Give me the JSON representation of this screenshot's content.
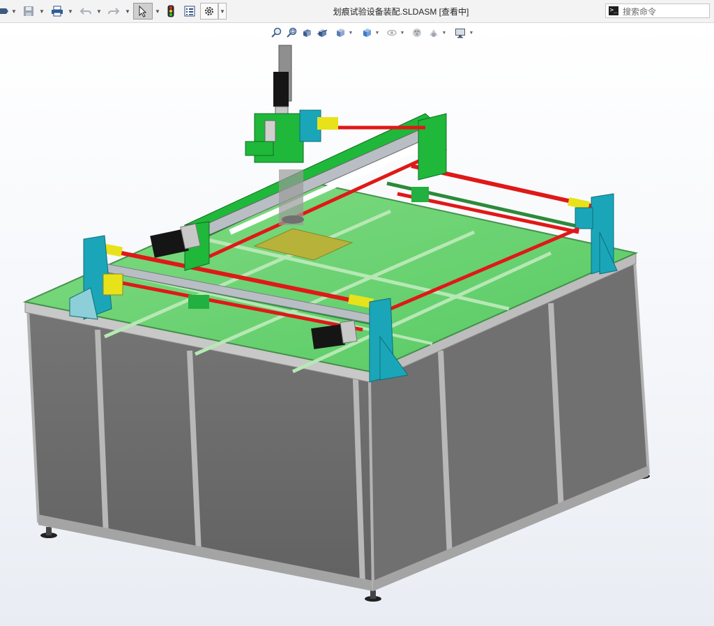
{
  "toolbar": {
    "items": [
      {
        "name": "open-menu-icon"
      },
      {
        "name": "save-icon"
      },
      {
        "name": "print-icon"
      },
      {
        "name": "undo-icon"
      },
      {
        "name": "redo-icon"
      },
      {
        "name": "select-icon",
        "selected": true
      },
      {
        "name": "rebuild-traffic-light-icon"
      },
      {
        "name": "file-properties-icon"
      },
      {
        "name": "options-gear-icon"
      }
    ]
  },
  "document": {
    "title": "划痕试验设备装配.SLDASM [查看中]"
  },
  "search": {
    "placeholder": "搜索命令",
    "icon_glyph": ">_"
  },
  "view_toolbar": {
    "items": [
      "zoom-to-fit-icon",
      "zoom-to-area-icon",
      "previous-view-icon",
      "section-view-icon",
      "view-orientation-icon",
      "display-style-icon",
      "hide-show-items-icon",
      "edit-appearance-icon",
      "apply-scene-icon",
      "view-settings-icon"
    ]
  },
  "colors": {
    "frame_panel": "#6e6e6e",
    "frame_edge": "#a9a9a9",
    "glass_top": "#62d06a",
    "gantry_green": "#1fb83a",
    "bracket_cyan": "#1aa6b8",
    "rod_red": "#e01818",
    "motor_black": "#151515",
    "accent_yellow": "#e8e21a"
  }
}
